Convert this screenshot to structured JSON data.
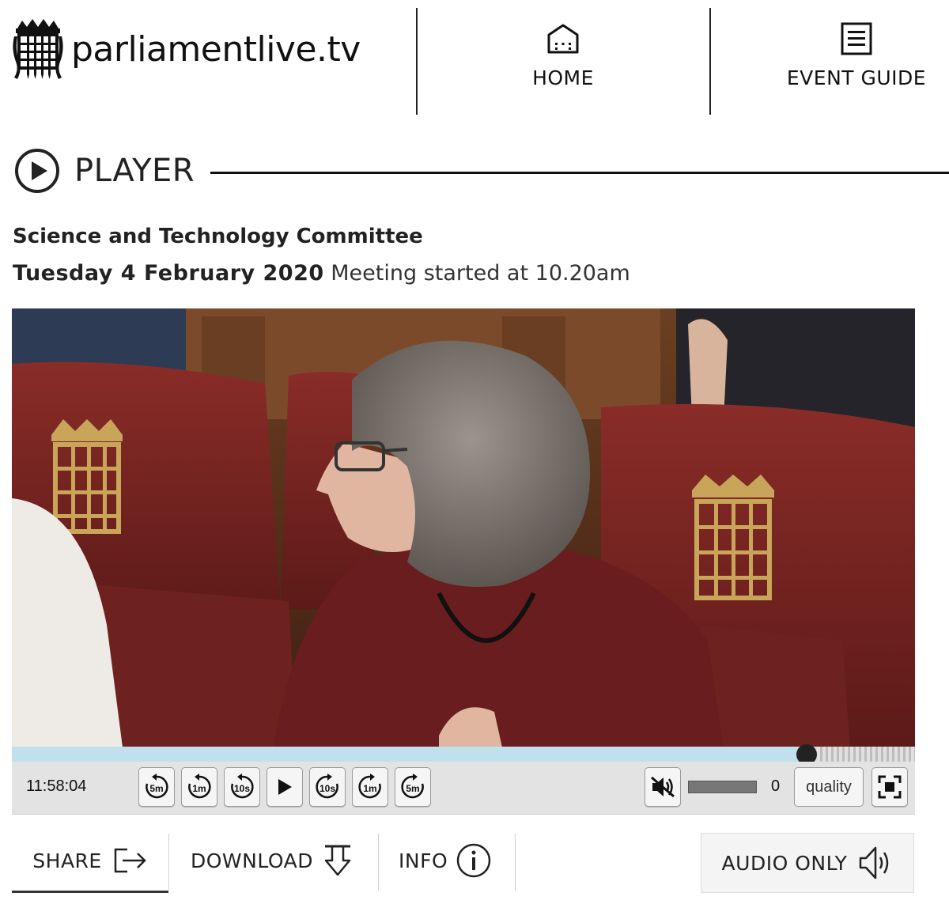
{
  "header": {
    "logo_text": "parliamentlive.tv",
    "nav": [
      {
        "label": "HOME",
        "icon": "home-icon"
      },
      {
        "label": "EVENT GUIDE",
        "icon": "document-list-icon"
      }
    ]
  },
  "player": {
    "heading": "PLAYER",
    "committee": "Science and Technology Committee",
    "date": "Tuesday 4 February 2020",
    "started": "Meeting started at 10.20am",
    "progress_fraction": 0.88
  },
  "controls": {
    "time": "11:58:04",
    "seek_back": [
      "5m",
      "1m",
      "10s"
    ],
    "seek_forward": [
      "10s",
      "1m",
      "5m"
    ],
    "volume_value": "0",
    "volume_level": 1.0,
    "muted": true,
    "quality_label": "quality"
  },
  "tabs": {
    "share": "SHARE",
    "download": "DOWNLOAD",
    "info": "INFO",
    "audio_only": "AUDIO ONLY"
  },
  "colors": {
    "progress": "#c7dfe9",
    "controls_bg": "#e3e3e3",
    "seat_leather": "#7a2523",
    "crest_gold": "#c9a55a"
  }
}
